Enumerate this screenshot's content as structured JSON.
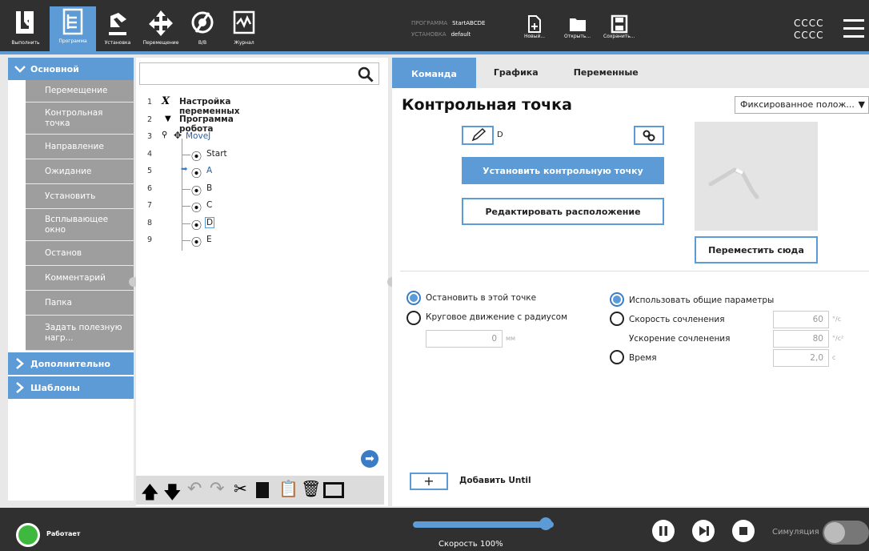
{
  "topbar": {
    "tabs": [
      {
        "label": "Выполнить",
        "icon": "ur-logo-icon"
      },
      {
        "label": "Программа",
        "icon": "program-tree-icon"
      },
      {
        "label": "Установка",
        "icon": "robot-arm-icon"
      },
      {
        "label": "Перемещение",
        "icon": "move-arrows-icon"
      },
      {
        "label": "В/В",
        "icon": "io-icon"
      },
      {
        "label": "Журнал",
        "icon": "log-icon"
      }
    ],
    "program_label": "ПРОГРАММА",
    "program_value": "StartABCDE",
    "install_label": "УСТАНОВКА",
    "install_value": "default",
    "new_label": "Новый...",
    "open_label": "Открыть...",
    "save_label": "Сохранить...",
    "user_line1": "CCCC",
    "user_line2": "CCCC",
    "accent": "#5c9bd5"
  },
  "sidebar": {
    "basic": "Основной",
    "items": [
      "Перемещение",
      "Контрольная точка",
      "Направление",
      "Ожидание",
      "Установить",
      "Всплывающее окно",
      "Останов",
      "Комментарий",
      "Папка",
      "Задать полезную нагр..."
    ],
    "advanced": "Дополнительно",
    "templates": "Шаблоны"
  },
  "tree": {
    "rows": [
      {
        "num": "1",
        "label": "Настройка переменных"
      },
      {
        "num": "2",
        "label": "Программа робота"
      },
      {
        "num": "3",
        "label": "MoveJ"
      },
      {
        "num": "4",
        "label": "Start"
      },
      {
        "num": "5",
        "label": "A"
      },
      {
        "num": "6",
        "label": "B"
      },
      {
        "num": "7",
        "label": "C"
      },
      {
        "num": "8",
        "label": "D"
      },
      {
        "num": "9",
        "label": "E"
      }
    ]
  },
  "main": {
    "tabs": [
      "Команда",
      "Графика",
      "Переменные"
    ],
    "title": "Контрольная точка",
    "dropdown": "Фиксированное полож...",
    "point_name": "D",
    "set_waypoint": "Установить контрольную точку",
    "edit_pose": "Редактировать расположение",
    "move_here": "Переместить сюда",
    "stop_at": "Остановить в этой точке",
    "blend": "Круговое движение с радиусом",
    "blend_value": "0",
    "blend_unit": "мм",
    "shared": "Использовать общие параметры",
    "joint_speed": "Скорость сочленения",
    "joint_speed_value": "60",
    "joint_speed_unit": "°/с",
    "joint_accel": "Ускорение сочленения",
    "joint_accel_value": "80",
    "joint_accel_unit": "°/с²",
    "time": "Время",
    "time_value": "2,0",
    "time_unit": "с",
    "add_until": "Добавить Until"
  },
  "bottombar": {
    "status": "Работает",
    "speed": "Скорость 100%",
    "speed_fraction": 1.0,
    "simulation": "Симуляция"
  }
}
